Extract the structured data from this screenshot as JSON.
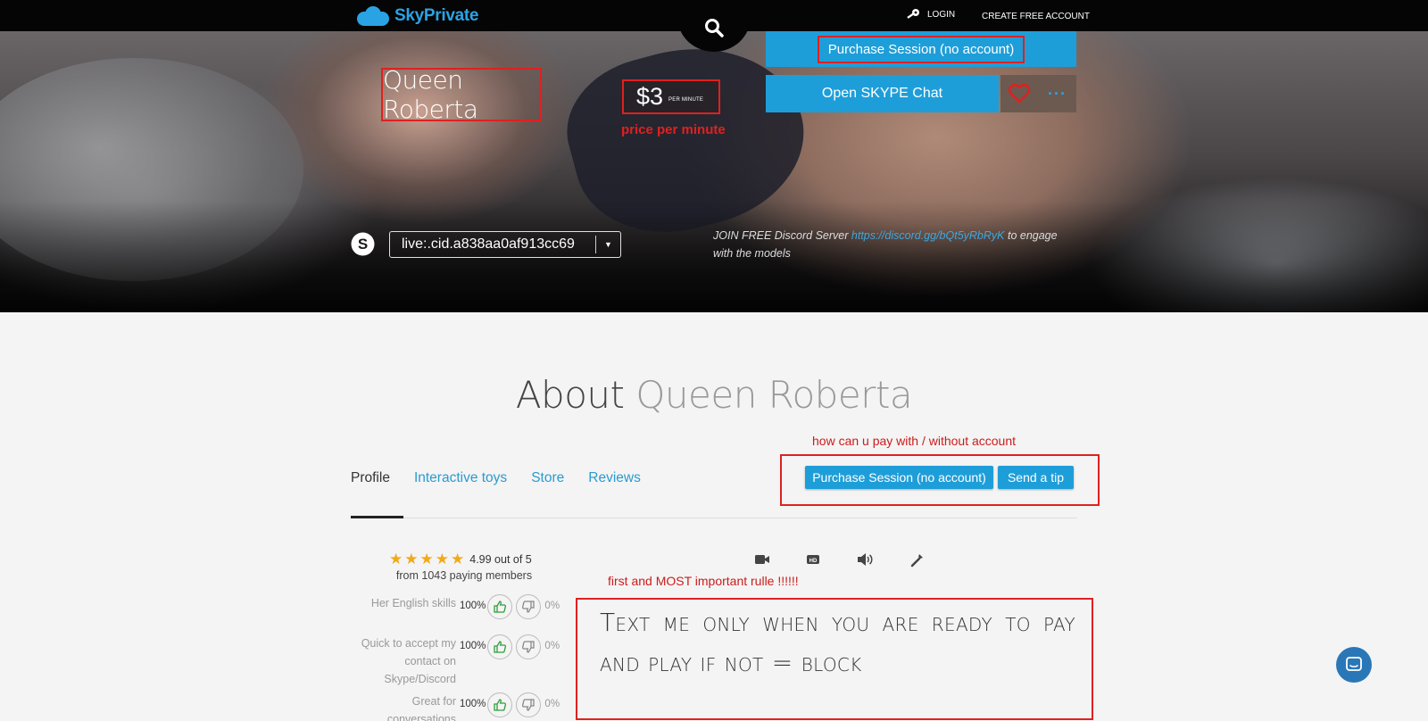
{
  "topbar": {
    "logo_text": "SkyPrivate",
    "login_label": "LOGIN",
    "create_account_label": "CREATE FREE ACCOUNT"
  },
  "hero": {
    "model_name": "Queen Roberta",
    "price": "$3",
    "price_unit": "PER MINUTE",
    "price_note": "price per minute",
    "purchase_button": "Purchase Session (no account)",
    "open_skype_button": "Open SKYPE Chat",
    "more_button": "···",
    "skype_id": "live:.cid.a838aa0af913cc69",
    "discord_prefix": "JOIN FREE Discord Server ",
    "discord_link": "https://discord.gg/bQt5yRbRyK",
    "discord_suffix": " to engage with the models"
  },
  "about": {
    "title_prefix": "About ",
    "title_name": "Queen Roberta",
    "tabs": [
      {
        "label": "Profile",
        "active": true
      },
      {
        "label": "Interactive toys",
        "active": false
      },
      {
        "label": "Store",
        "active": false
      },
      {
        "label": "Reviews",
        "active": false
      }
    ],
    "pay_note": "how can u pay with / without account",
    "purchase_button": "Purchase Session (no account)",
    "tip_button": "Send a tip"
  },
  "rating": {
    "stars": 5,
    "score_text": "4.99 out of 5",
    "members_text": "from 1043 paying members",
    "metrics": [
      {
        "label": "Her English skills",
        "up": "100%",
        "down": "0%"
      },
      {
        "label": "Quick to accept my contact on Skype/Discord",
        "up": "100%",
        "down": "0%"
      },
      {
        "label": "Great for conversations",
        "up": "100%",
        "down": "0%"
      }
    ]
  },
  "features": [
    "video-camera-icon",
    "hd-icon",
    "speaker-icon",
    "tools-icon"
  ],
  "rule": {
    "note": "first and MOST important rulle !!!!!!",
    "text": "Text me only when you are ready to pay and play if not = block"
  },
  "colors": {
    "accent": "#1e9ed9",
    "annotation_red": "#e02020",
    "star": "#f2a91a"
  }
}
